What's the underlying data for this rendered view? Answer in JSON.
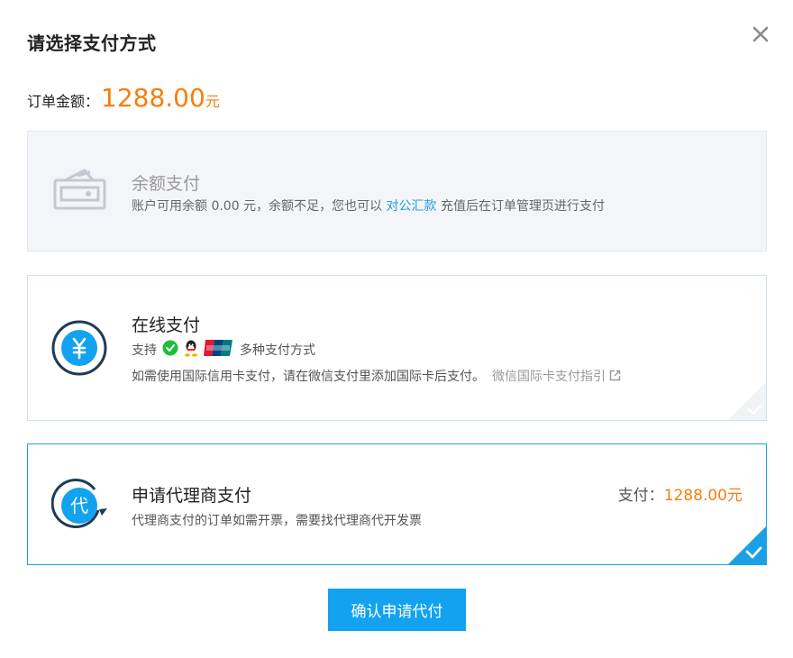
{
  "dialog": {
    "title": "请选择支付方式",
    "close_icon": "close-icon"
  },
  "order": {
    "label": "订单金额：",
    "amount": "1288.00",
    "unit": "元"
  },
  "methods": {
    "balance": {
      "title": "余额支付",
      "desc_before": "账户可用余额 0.00 元，余额不足，您也可以 ",
      "link": "对公汇款",
      "desc_after": " 充值后在订单管理页进行支付",
      "icon": "wallet-icon"
    },
    "online": {
      "title": "在线支付",
      "support_label": "支持",
      "more_label": "多种支付方式",
      "desc": "如需使用国际信用卡支付，请在微信支付里添加国际卡后支付。",
      "guide": "微信国际卡支付指引",
      "icons": [
        "yuan-icon",
        "wechat-icon",
        "qq-icon",
        "unionpay-icon",
        "external-link-icon"
      ]
    },
    "agent": {
      "title": "申请代理商支付",
      "desc": "代理商支付的订单如需开票，需要找代理商代开发票",
      "pay_label": "支付：",
      "pay_amount": "1288.00元",
      "icon_char": "代",
      "selected": true
    }
  },
  "confirm_button": "确认申请代付",
  "colors": {
    "accent": "#1ba0e6",
    "orange": "#f77e0b",
    "button": "#12a2f0"
  }
}
